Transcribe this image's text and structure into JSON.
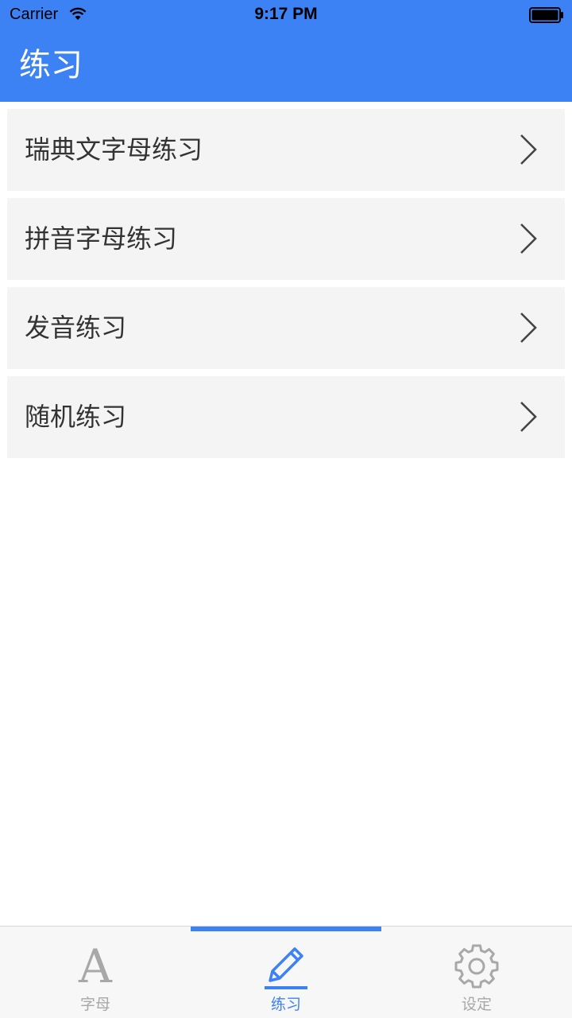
{
  "status_bar": {
    "carrier": "Carrier",
    "time": "9:17 PM"
  },
  "header": {
    "title": "练习"
  },
  "menu": {
    "items": [
      {
        "label": "瑞典文字母练习"
      },
      {
        "label": "拼音字母练习"
      },
      {
        "label": "发音练习"
      },
      {
        "label": "随机练习"
      }
    ]
  },
  "tab_bar": {
    "selected": 1,
    "tabs": [
      {
        "label": "字母",
        "icon": "letter-a-icon",
        "glyph": "A"
      },
      {
        "label": "练习",
        "icon": "pencil-icon"
      },
      {
        "label": "设定",
        "icon": "gear-icon"
      }
    ]
  },
  "colors": {
    "accent": "#3d82f5",
    "row_bg": "#f4f4f4",
    "inactive": "#a8a8a8",
    "text": "#333333"
  }
}
